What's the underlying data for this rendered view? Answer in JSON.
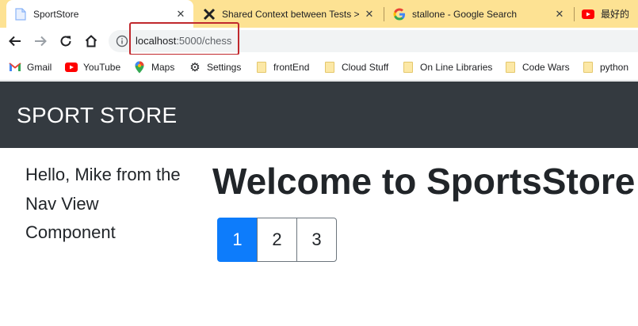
{
  "tabs": [
    {
      "title": "SportStore",
      "icon": "page-icon",
      "active": true
    },
    {
      "title": "Shared Context between Tests >",
      "icon": "xunit-icon",
      "active": false
    },
    {
      "title": "stallone - Google Search",
      "icon": "google-icon",
      "active": false
    },
    {
      "title": "最好的",
      "icon": "youtube-icon",
      "active": false
    }
  ],
  "toolbar": {
    "url_host": "localhost",
    "url_path": ":5000/chess"
  },
  "bookmarks": [
    {
      "label": "Gmail",
      "icon": "gmail-icon"
    },
    {
      "label": "YouTube",
      "icon": "youtube-icon"
    },
    {
      "label": "Maps",
      "icon": "maps-icon"
    },
    {
      "label": "Settings",
      "icon": "gear-icon"
    },
    {
      "label": "frontEnd",
      "icon": "folder-icon"
    },
    {
      "label": "Cloud Stuff",
      "icon": "folder-icon"
    },
    {
      "label": "On Line Libraries",
      "icon": "folder-icon"
    },
    {
      "label": "Code Wars",
      "icon": "folder-icon"
    },
    {
      "label": "python",
      "icon": "folder-icon"
    }
  ],
  "site": {
    "brand": "SPORT STORE",
    "nav_greeting": "Hello, Mike from the Nav View Component",
    "welcome": "Welcome to SportsStore",
    "pages": [
      "1",
      "2",
      "3"
    ],
    "active_page": "1"
  },
  "colors": {
    "tabstrip": "#fde293",
    "header": "#343a40",
    "active_page": "#0d7cfb",
    "url_highlight": "#c0282d"
  }
}
